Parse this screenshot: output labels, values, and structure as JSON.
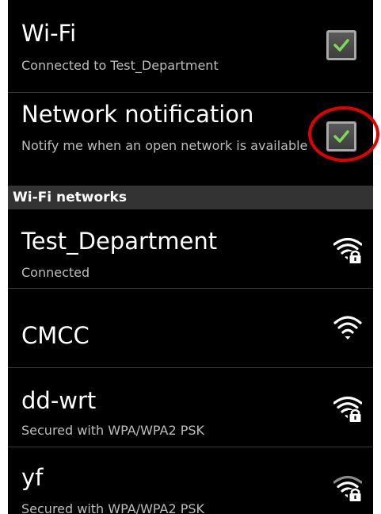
{
  "wifi": {
    "title": "Wi-Fi",
    "status": "Connected to Test_Department",
    "checked": true
  },
  "network_notification": {
    "title": "Network notification",
    "description": "Notify me when an open network is available",
    "checked": true
  },
  "networks_header": "Wi-Fi networks",
  "networks": [
    {
      "name": "Test_Department",
      "status": "Connected",
      "icon": "wifi-locked-icon"
    },
    {
      "name": "CMCC",
      "status": "",
      "icon": "wifi-open-icon"
    },
    {
      "name": "dd-wrt",
      "status": "Secured with WPA/WPA2 PSK",
      "icon": "wifi-locked-icon"
    },
    {
      "name": "yf",
      "status": "Secured with WPA/WPA2 PSK",
      "icon": "wifi-locked-icon"
    }
  ],
  "colors": {
    "background": "#000000",
    "section_header": "#333333",
    "check_green": "#7ed957",
    "annotation_red": "#e30000"
  }
}
